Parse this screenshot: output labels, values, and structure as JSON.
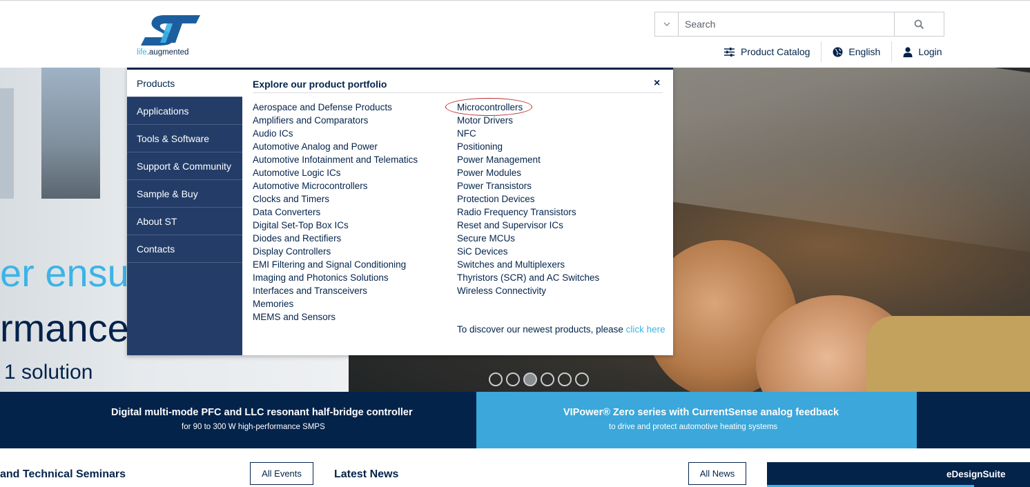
{
  "header": {
    "logo_text": "ST",
    "logo_tagline_prefix": "life",
    "logo_tagline_suffix": ".augmented",
    "search": {
      "placeholder": "Search"
    },
    "utility": [
      {
        "label": "Product Catalog",
        "icon": "sliders-icon"
      },
      {
        "label": "English",
        "icon": "globe-icon"
      },
      {
        "label": "Login",
        "icon": "user-icon"
      }
    ]
  },
  "hero": {
    "line1": "er ensures",
    "line2": "rmances",
    "line3": "1 solution",
    "slides": 6,
    "active_slide": 3
  },
  "mega_menu": {
    "nav": [
      "Products",
      "Applications",
      "Tools & Software",
      "Support & Community",
      "Sample & Buy",
      "About ST",
      "Contacts"
    ],
    "active_nav": "Products",
    "title": "Explore our product portfolio",
    "close": "×",
    "col1": [
      "Aerospace and Defense Products",
      "Amplifiers and Comparators",
      "Audio ICs",
      "Automotive Analog and Power",
      "Automotive Infotainment and Telematics",
      "Automotive Logic ICs",
      "Automotive Microcontrollers",
      "Clocks and Timers",
      "Data Converters",
      "Digital Set-Top Box ICs",
      "Diodes and Rectifiers",
      "Display Controllers",
      "EMI Filtering and Signal Conditioning",
      "Imaging and Photonics Solutions",
      "Interfaces and Transceivers",
      "Memories",
      "MEMS and Sensors"
    ],
    "col2": [
      "Microcontrollers",
      "Motor Drivers",
      "NFC",
      "Positioning",
      "Power Management",
      "Power Modules",
      "Power Transistors",
      "Protection Devices",
      "Radio Frequency Transistors",
      "Reset and Supervisor ICs",
      "Secure MCUs",
      "SiC Devices",
      "Switches and Multiplexers",
      "Thyristors (SCR) and AC Switches",
      "Wireless Connectivity"
    ],
    "discover_text": "To discover our newest products, please ",
    "discover_link": "click here"
  },
  "promo": {
    "left_title": "Digital multi-mode PFC and LLC resonant half-bridge controller",
    "left_sub": "for 90 to 300 W high-performance SMPS",
    "right_title": "VIPower® Zero series with CurrentSense analog feedback",
    "right_sub": "to drive and protect automotive heating systems"
  },
  "bottom": {
    "events_heading": "and Technical Seminars",
    "events_button": "All Events",
    "news_heading": "Latest News",
    "news_button": "All News",
    "edesign_label": "eDesignSuite"
  },
  "colors": {
    "navy": "#03234b",
    "light_blue": "#3cb4e6",
    "nav_bg": "#233d68",
    "promo_blue": "#3ba7da",
    "annotation_red": "#b8282c"
  }
}
